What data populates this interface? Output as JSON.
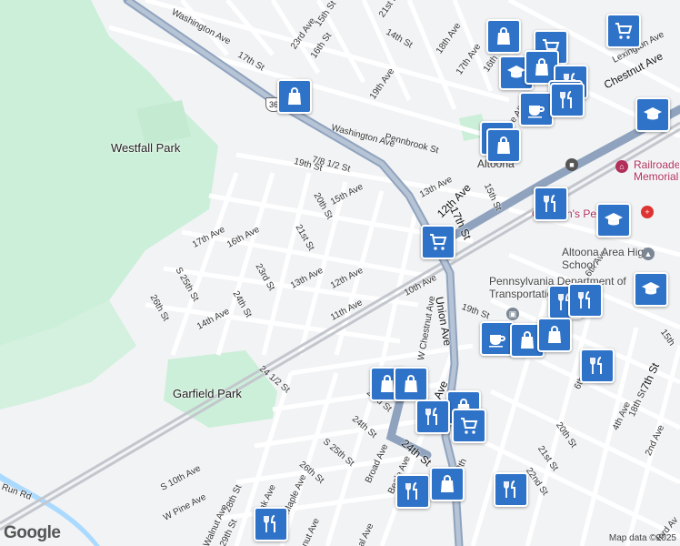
{
  "parks": [
    {
      "name": "Westfall Park"
    },
    {
      "name": "Garfield Park"
    }
  ],
  "streets": [
    {
      "name": "Washington Ave"
    },
    {
      "name": "15th St"
    },
    {
      "name": "23rd Ave"
    },
    {
      "name": "16th St"
    },
    {
      "name": "17th St"
    },
    {
      "name": "21st St"
    },
    {
      "name": "14th St"
    },
    {
      "name": "18th Ave"
    },
    {
      "name": "17th Ave"
    },
    {
      "name": "16th"
    },
    {
      "name": "19th Ave"
    },
    {
      "name": "Lexington Ave"
    },
    {
      "name": "Chestnut Ave"
    },
    {
      "name": "Pennbrook St"
    },
    {
      "name": "Washington Ave"
    },
    {
      "name": "7/8 1/2 St"
    },
    {
      "name": "19th St"
    },
    {
      "name": "15th Ave"
    },
    {
      "name": "13th Ave Alley"
    },
    {
      "name": "20th St"
    },
    {
      "name": "13th Ave"
    },
    {
      "name": "12th Ave"
    },
    {
      "name": "17th St"
    },
    {
      "name": "15th St"
    },
    {
      "name": "17th Ave"
    },
    {
      "name": "16th Ave"
    },
    {
      "name": "21st St"
    },
    {
      "name": "23rd St"
    },
    {
      "name": "13th Ave"
    },
    {
      "name": "12th Ave"
    },
    {
      "name": "S 25th St"
    },
    {
      "name": "24th St"
    },
    {
      "name": "26th St"
    },
    {
      "name": "14th Ave"
    },
    {
      "name": "11th Ave"
    },
    {
      "name": "10th Ave"
    },
    {
      "name": "W Chestnut Ave"
    },
    {
      "name": "Union Ave"
    },
    {
      "name": "19th St"
    },
    {
      "name": "24 1/2 St"
    },
    {
      "name": "23rd St"
    },
    {
      "name": "24th St"
    },
    {
      "name": "Beale Ave"
    },
    {
      "name": "S 25th St"
    },
    {
      "name": "26th St"
    },
    {
      "name": "Broad Ave"
    },
    {
      "name": "Beale Ave"
    },
    {
      "name": "24th St"
    },
    {
      "name": "S 10th Ave"
    },
    {
      "name": "W Pine Ave"
    },
    {
      "name": "28th St"
    },
    {
      "name": "Oak Ave"
    },
    {
      "name": "Maple Ave"
    },
    {
      "name": "Walnut Ave"
    },
    {
      "name": "29th St"
    },
    {
      "name": "Run Rd"
    },
    {
      "name": "6th Ave"
    },
    {
      "name": "7th St"
    },
    {
      "name": "4th Ave"
    },
    {
      "name": "18th St"
    },
    {
      "name": "2nd Ave"
    },
    {
      "name": "20th St"
    },
    {
      "name": "21st St"
    },
    {
      "name": "22nd St"
    },
    {
      "name": "15th"
    },
    {
      "name": "ford Av"
    },
    {
      "name": "6th Ave"
    },
    {
      "name": "8th"
    },
    {
      "name": "al Ave"
    },
    {
      "name": "nut Ave"
    }
  ],
  "pois": [
    {
      "name": "Altoona"
    },
    {
      "name": "Railroaders Memorial"
    },
    {
      "name": "Children's Pediatrics"
    },
    {
      "name": "Altoona Area High School"
    },
    {
      "name": "Pennsylvania Department of Transportation..."
    }
  ],
  "highway": {
    "number": "36"
  },
  "markers": [
    {
      "icon": "shopping-bag-icon"
    },
    {
      "icon": "shopping-bag-icon"
    },
    {
      "icon": "shopping-cart-icon"
    },
    {
      "icon": "shopping-cart-icon"
    },
    {
      "icon": "graduation-cap-icon"
    },
    {
      "icon": "shopping-bag-icon"
    },
    {
      "icon": "restaurant-icon"
    },
    {
      "icon": "restaurant-icon"
    },
    {
      "icon": "coffee-cup-icon"
    },
    {
      "icon": "restaurant-icon"
    },
    {
      "icon": "shopping-bag-icon"
    },
    {
      "icon": "shopping-bag-icon"
    },
    {
      "icon": "graduation-cap-icon"
    },
    {
      "icon": "restaurant-icon"
    },
    {
      "icon": "graduation-cap-icon"
    },
    {
      "icon": "shopping-cart-icon"
    },
    {
      "icon": "restaurant-icon"
    },
    {
      "icon": "graduation-cap-icon"
    },
    {
      "icon": "coffee-cup-icon"
    },
    {
      "icon": "shopping-bag-icon"
    },
    {
      "icon": "shopping-bag-icon"
    },
    {
      "icon": "restaurant-icon"
    },
    {
      "icon": "restaurant-icon"
    },
    {
      "icon": "shopping-bag-icon"
    },
    {
      "icon": "shopping-bag-icon"
    },
    {
      "icon": "shopping-bag-icon"
    },
    {
      "icon": "restaurant-icon"
    },
    {
      "icon": "shopping-cart-icon"
    },
    {
      "icon": "restaurant-icon"
    },
    {
      "icon": "shopping-bag-icon"
    },
    {
      "icon": "restaurant-icon"
    },
    {
      "icon": "restaurant-icon"
    }
  ],
  "attribution": "Map data ©2025",
  "logo": "Google",
  "colors": {
    "marker": "#2f73c9",
    "park": "#ccefd9",
    "highway": "#8fa3be",
    "water": "#aadaff",
    "road": "#ffffff",
    "railway": "#c3c7cd"
  }
}
